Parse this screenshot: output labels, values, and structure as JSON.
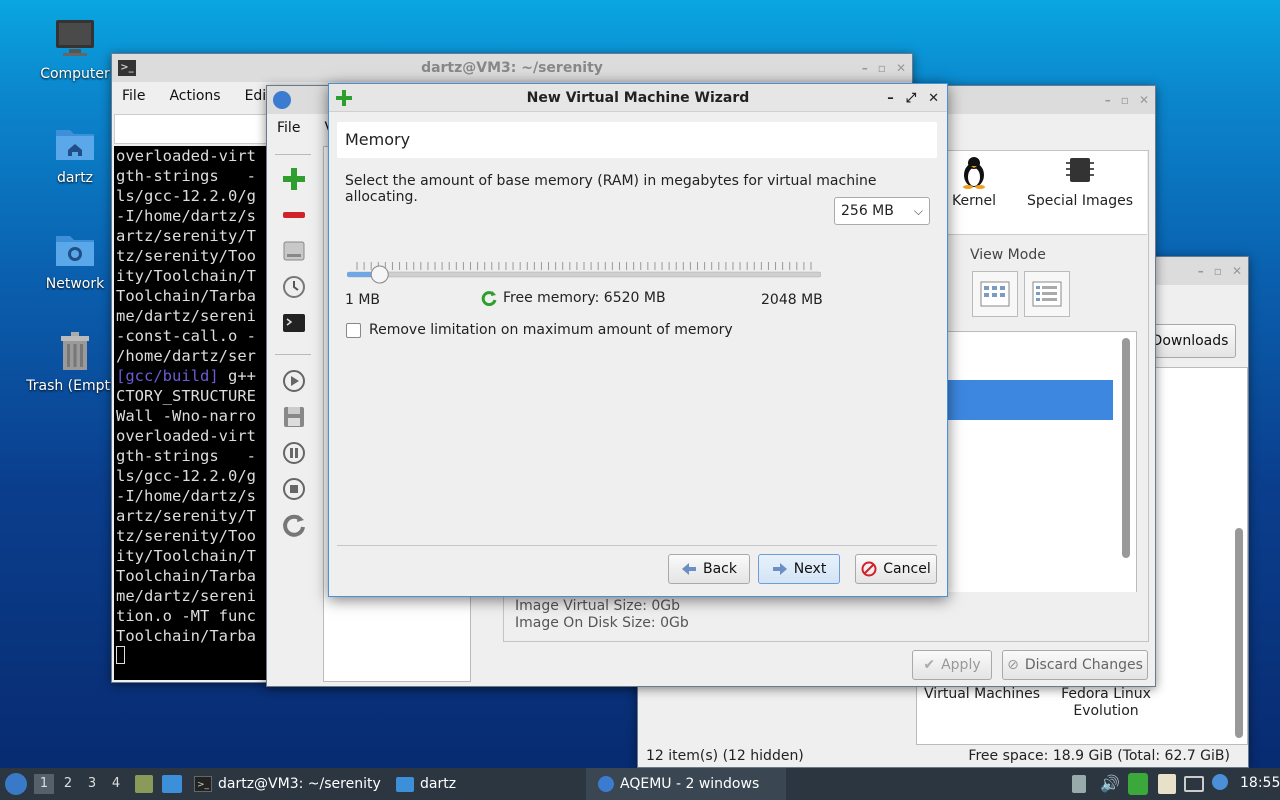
{
  "desktop": {
    "icons": [
      {
        "label": "Computer",
        "icon": "computer-icon"
      },
      {
        "label": "dartz",
        "icon": "home-folder-icon"
      },
      {
        "label": "Network",
        "icon": "network-folder-icon"
      },
      {
        "label": "Trash (Empty)",
        "icon": "trash-icon"
      }
    ]
  },
  "terminal": {
    "title": "dartz@VM3: ~/serenity",
    "menu": [
      "File",
      "Actions",
      "Edit"
    ],
    "lines": [
      "overloaded-virt",
      "gth-strings   -",
      "ls/gcc-12.2.0/g",
      "-I/home/dartz/s",
      "artz/serenity/T",
      "tz/serenity/Too",
      "ity/Toolchain/T",
      "Toolchain/Tarba",
      "me/dartz/sereni",
      "-const-call.o -",
      "/home/dartz/ser",
      "[gcc/build] g++",
      "CTORY_STRUCTURE",
      "Wall -Wno-narro",
      "overloaded-virt",
      "gth-strings   -",
      "ls/gcc-12.2.0/g",
      "-I/home/dartz/s",
      "artz/serenity/T",
      "tz/serenity/Too",
      "ity/Toolchain/T",
      "Toolchain/Tarba",
      "me/dartz/sereni",
      "tion.o -MT func",
      "Toolchain/Tarba"
    ],
    "highlight_prefix": "[gcc/build]",
    "highlight_suffix": " g++"
  },
  "aqemu": {
    "menu": [
      "File",
      "V"
    ],
    "info": {
      "virtual_size": "Image Virtual Size: 0Gb",
      "disk_size": "Image On Disk Size: 0Gb"
    },
    "apply_label": "Apply",
    "discard_label": "Discard Changes",
    "kernel_label": "Kernel",
    "special_images_label": "Special Images",
    "view_mode_label": "View Mode"
  },
  "file_manager": {
    "downloads_label": "Downloads",
    "items": [
      "Virtual Machines",
      "Fedora Linux Evolution"
    ],
    "status_left": "12 item(s) (12 hidden)",
    "status_right": "Free space: 18.9 GiB (Total: 62.7 GiB)"
  },
  "wizard": {
    "title": "New Virtual Machine Wizard",
    "section": "Memory",
    "description": "Select the amount of base memory (RAM) in megabytes for virtual machine allocating.",
    "memory_value": "256 MB",
    "slider_min": "1 MB",
    "slider_max": "2048 MB",
    "slider_fraction": 0.05,
    "free_memory": "Free memory: 6520 MB",
    "remove_limit_label": "Remove limitation on maximum amount of memory",
    "back_label": "Back",
    "next_label": "Next",
    "cancel_label": "Cancel"
  },
  "taskbar": {
    "workspaces": [
      "1",
      "2",
      "3",
      "4"
    ],
    "active_workspace": "1",
    "tasks": [
      {
        "label": "dartz@VM3: ~/serenity",
        "icon": "terminal-icon"
      },
      {
        "label": "dartz",
        "icon": "folder-icon"
      },
      {
        "label": "AQEMU - 2 windows",
        "icon": "aqemu-icon"
      }
    ],
    "clock": "18:55"
  },
  "colors": {
    "accent": "#4a90d9",
    "selection": "#3d87e0",
    "taskbar": "#2b3640"
  }
}
